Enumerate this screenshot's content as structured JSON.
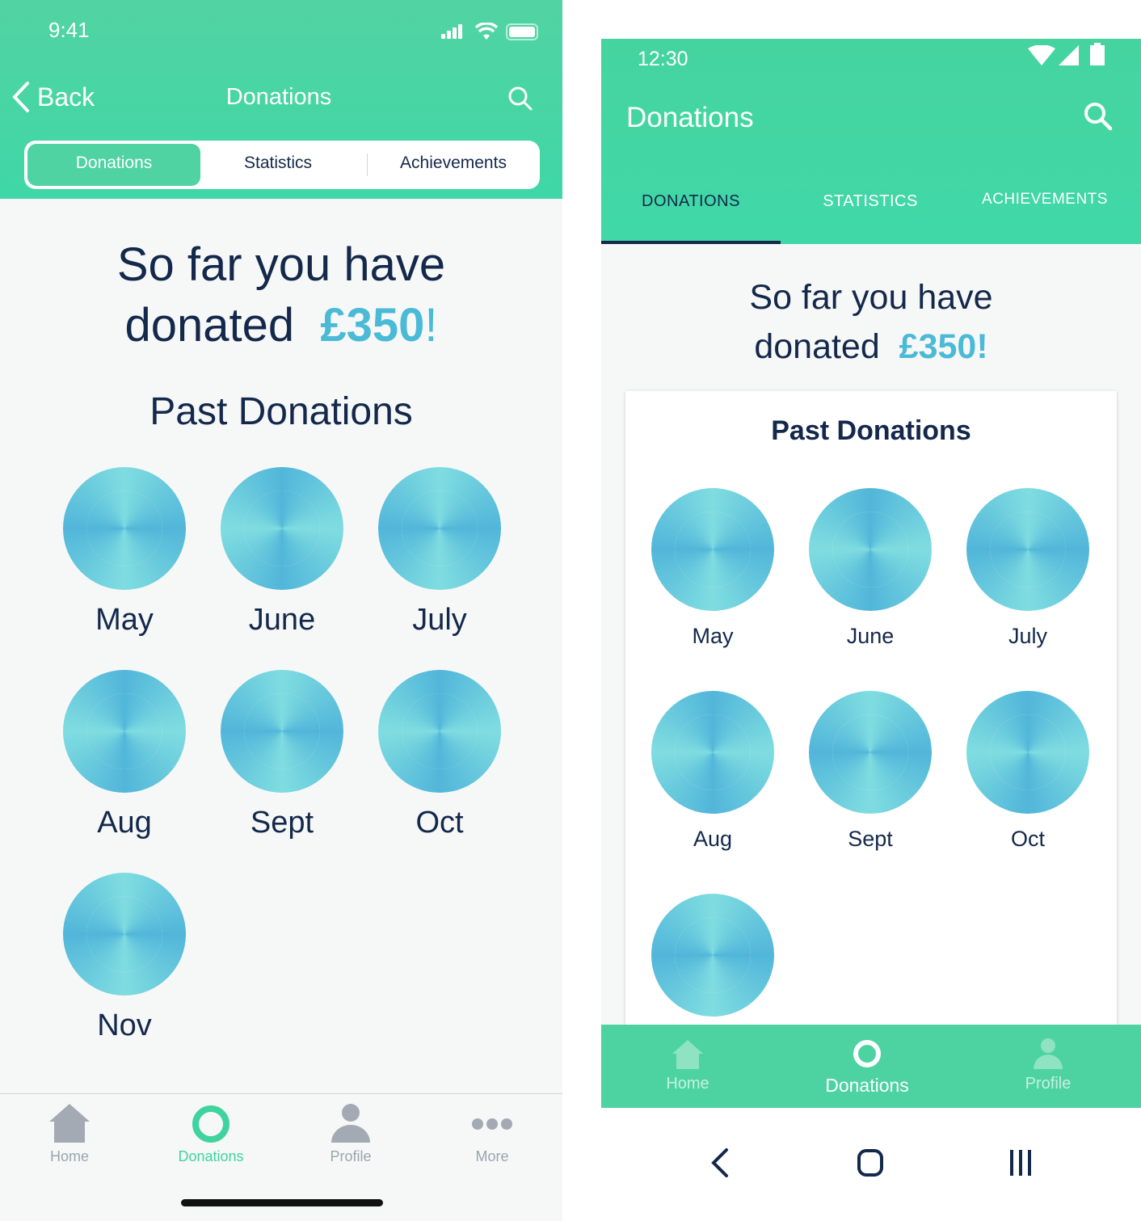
{
  "ios": {
    "status": {
      "time": "9:41"
    },
    "nav": {
      "back_label": "Back",
      "title": "Donations"
    },
    "segments": [
      "Donations",
      "Statistics",
      "Achievements"
    ],
    "summary": {
      "prefix_line1": "So far you have",
      "prefix_line2": "donated",
      "amount": "£350",
      "suffix": "!"
    },
    "past_title": "Past Donations",
    "months": [
      "May",
      "June",
      "July",
      "Aug",
      "Sept",
      "Oct",
      "Nov"
    ],
    "tabbar": [
      {
        "label": "Home",
        "icon": "house-icon"
      },
      {
        "label": "Donations",
        "icon": "ring-icon"
      },
      {
        "label": "Profile",
        "icon": "person-icon"
      },
      {
        "label": "More",
        "icon": "ellipsis-icon"
      }
    ]
  },
  "android": {
    "status": {
      "time": "12:30"
    },
    "appbar": {
      "title": "Donations"
    },
    "tabs": [
      "DONATIONS",
      "STATISTICS",
      "ACHIEVEMENTS"
    ],
    "summary": {
      "prefix_line1": "So far you have",
      "prefix_line2": "donated",
      "amount": "£350!"
    },
    "past_title": "Past Donations",
    "months": [
      "May",
      "June",
      "July",
      "Aug",
      "Sept",
      "Oct"
    ],
    "bottom_nav": [
      {
        "label": "Home",
        "icon": "house-icon"
      },
      {
        "label": "Donations",
        "icon": "ring-icon"
      },
      {
        "label": "Profile",
        "icon": "person-icon"
      }
    ]
  },
  "colors": {
    "header_green": "#45d4a0",
    "accent_blue": "#4bbad6",
    "donut_light": "#7fdde0",
    "donut_dark": "#52b6da",
    "text_navy": "#14284b"
  }
}
